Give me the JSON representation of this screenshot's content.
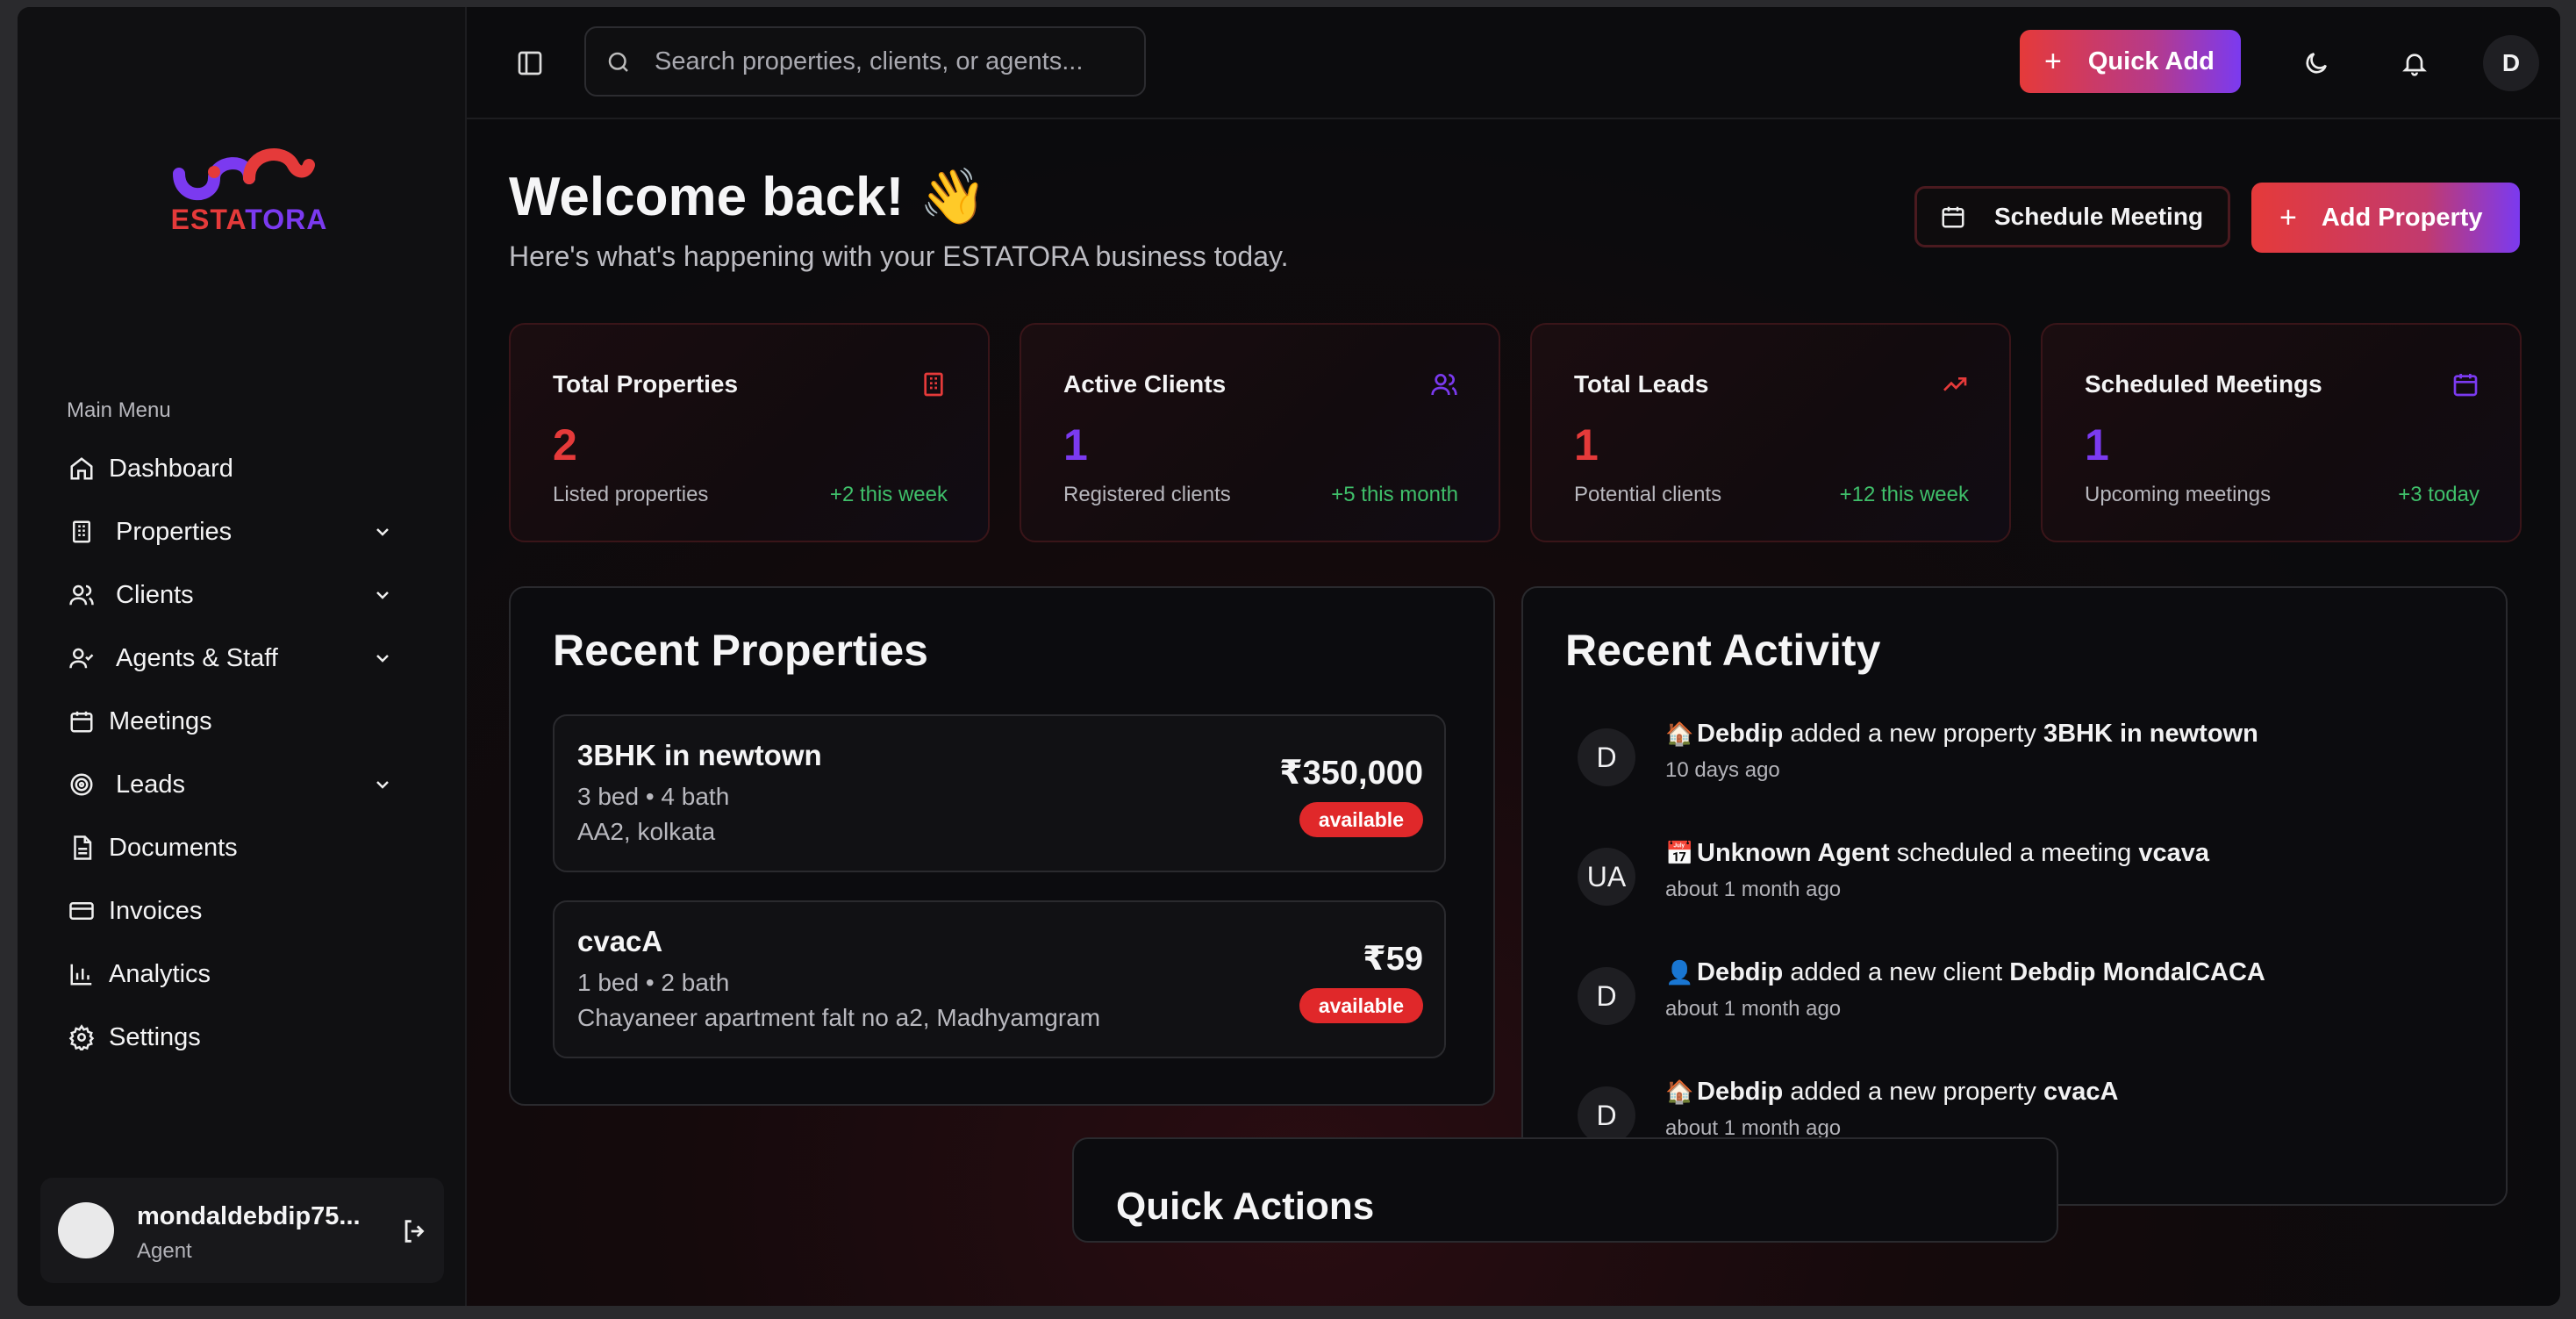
{
  "brand": {
    "name_part1": "ESTA",
    "name_part2": "TORA",
    "colors": {
      "red": "#e53a3a",
      "purple": "#7b3af0"
    }
  },
  "search": {
    "placeholder": "Search properties, clients, or agents..."
  },
  "topbar": {
    "quick_add_label": "Quick Add",
    "avatar_initial": "D"
  },
  "sidebar": {
    "menu_title": "Main Menu",
    "items": [
      {
        "label": "Dashboard",
        "icon": "home-icon",
        "has_sub": false
      },
      {
        "label": "Properties",
        "icon": "building-icon",
        "has_sub": true
      },
      {
        "label": "Clients",
        "icon": "users-icon",
        "has_sub": true
      },
      {
        "label": "Agents & Staff",
        "icon": "user-check-icon",
        "has_sub": true
      },
      {
        "label": "Meetings",
        "icon": "calendar-icon",
        "has_sub": false
      },
      {
        "label": "Leads",
        "icon": "target-icon",
        "has_sub": true
      },
      {
        "label": "Documents",
        "icon": "document-icon",
        "has_sub": false
      },
      {
        "label": "Invoices",
        "icon": "credit-card-icon",
        "has_sub": false
      },
      {
        "label": "Analytics",
        "icon": "bar-chart-icon",
        "has_sub": false
      },
      {
        "label": "Settings",
        "icon": "gear-icon",
        "has_sub": false
      }
    ],
    "user": {
      "name": "mondaldebdip75...",
      "role": "Agent"
    }
  },
  "header": {
    "title": "Welcome back! 👋",
    "subtitle": "Here's what's happening with your ESTATORA business today.",
    "schedule_label": "Schedule Meeting",
    "add_property_label": "Add Property"
  },
  "stats": [
    {
      "title": "Total Properties",
      "value": "2",
      "label": "Listed properties",
      "change": "+2 this week",
      "icon": "building-icon",
      "color": "#e53a3a"
    },
    {
      "title": "Active Clients",
      "value": "1",
      "label": "Registered clients",
      "change": "+5 this month",
      "icon": "users-icon",
      "color": "#7b3af0"
    },
    {
      "title": "Total Leads",
      "value": "1",
      "label": "Potential clients",
      "change": "+12 this week",
      "icon": "trending-up-icon",
      "color": "#e53a3a"
    },
    {
      "title": "Scheduled Meetings",
      "value": "1",
      "label": "Upcoming meetings",
      "change": "+3 today",
      "icon": "calendar-icon",
      "color": "#7b3af0"
    }
  ],
  "recent_properties": {
    "title": "Recent Properties",
    "items": [
      {
        "name": "3BHK in newtown",
        "beds": "3 bed • 4 bath",
        "address": "AA2, kolkata",
        "price": "₹350,000",
        "status": "available"
      },
      {
        "name": "cvacA",
        "beds": "1 bed • 2 bath",
        "address": "Chayaneer apartment falt no a2, Madhyamgram",
        "price": "₹59",
        "status": "available"
      }
    ]
  },
  "recent_activity": {
    "title": "Recent Activity",
    "items": [
      {
        "avatar": "D",
        "emoji": "🏠",
        "actor": "Debdip",
        "action": "added a new property",
        "target": "3BHK in newtown",
        "time": "10 days ago"
      },
      {
        "avatar": "UA",
        "emoji": "📅",
        "actor": "Unknown Agent",
        "action": "scheduled a meeting",
        "target": "vcava",
        "time": "about 1 month ago"
      },
      {
        "avatar": "D",
        "emoji": "👤",
        "actor": "Debdip",
        "action": "added a new client",
        "target": "Debdip MondalCACA",
        "time": "about 1 month ago"
      },
      {
        "avatar": "D",
        "emoji": "🏠",
        "actor": "Debdip",
        "action": "added a new property",
        "target": "cvacA",
        "time": "about 1 month ago"
      }
    ]
  },
  "quick_actions": {
    "title": "Quick Actions"
  }
}
